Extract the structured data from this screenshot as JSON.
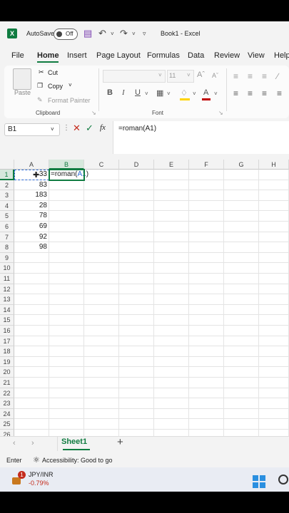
{
  "titlebar": {
    "autosave_label": "AutoSave",
    "toggle_state": "Off",
    "document_title": "Book1 - Excel"
  },
  "menu": {
    "items": [
      "File",
      "Home",
      "Insert",
      "Page Layout",
      "Formulas",
      "Data",
      "Review",
      "View",
      "Help"
    ],
    "active": "Home"
  },
  "ribbon": {
    "paste_label": "Paste",
    "cut_label": "Cut",
    "copy_label": "Copy",
    "format_painter_label": "Format Painter",
    "clipboard_group": "Clipboard",
    "font_group": "Font",
    "font_size": "11",
    "bold": "B",
    "italic": "I",
    "underline": "U"
  },
  "formula_bar": {
    "name_box": "B1",
    "fx_label": "fx",
    "formula": "=roman(A1)"
  },
  "grid": {
    "columns": [
      "A",
      "B",
      "C",
      "D",
      "E",
      "F",
      "G",
      "H"
    ],
    "rows": [
      "1",
      "2",
      "3",
      "4",
      "5",
      "6",
      "7",
      "8",
      "9",
      "10",
      "11",
      "12",
      "13",
      "14",
      "15",
      "16",
      "17",
      "18",
      "19",
      "20",
      "21",
      "22",
      "23",
      "24",
      "25",
      "26"
    ],
    "col_a_values": [
      "33",
      "83",
      "183",
      "28",
      "78",
      "69",
      "92",
      "98"
    ],
    "b1_prefix": "=roman(",
    "b1_ref": "A1",
    "b1_suffix": ")"
  },
  "sheets": {
    "active": "Sheet1",
    "add_label": "+"
  },
  "status": {
    "mode": "Enter",
    "accessibility": "Accessibility: Good to go"
  },
  "taskbar": {
    "badge_count": "1",
    "ticker": "JPY/INR",
    "change": "-0.79%",
    "change_color": "#c42b1c"
  },
  "colors": {
    "accent": "#107c41"
  }
}
